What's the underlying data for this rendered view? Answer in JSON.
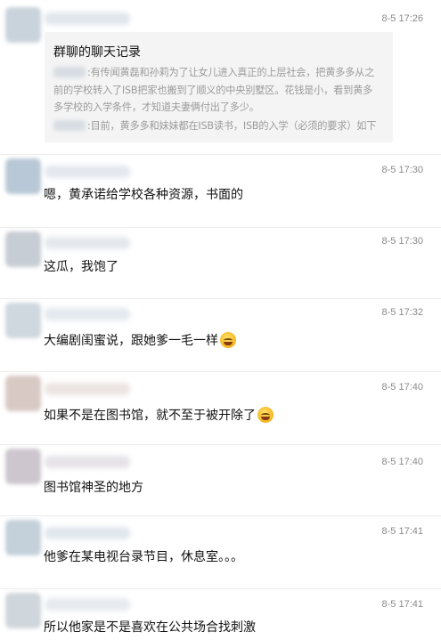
{
  "messages": [
    {
      "time": "8-5 17:26",
      "card": {
        "title": "群聊的聊天记录",
        "lines": [
          ":有传闻黄磊和孙莉为了让女儿进入真正的上层社会，把黄多多从之",
          "前的学校转入了ISB把家也搬到了顺义的中央别墅区。花钱是小，看到黄多",
          "多学校的入学条件，才知道夫妻俩付出了多少。",
          ":目前，黄多多和妹妹都在ISB读书，ISB的入学（必须的要求）如下"
        ]
      },
      "avatar_color": "#c9d3dc"
    },
    {
      "time": "8-5 17:30",
      "text": "嗯，黄承诺给学校各种资源，书面的",
      "avatar_color": "#b9c8d6"
    },
    {
      "time": "8-5 17:30",
      "text": "这瓜，我饱了",
      "avatar_color": "#c7cdd4"
    },
    {
      "time": "8-5 17:32",
      "text": "大编剧闺蜜说，跟她爹一毛一样",
      "emoji": "grinning-sweat-emoji",
      "avatar_color": "#cfd8df"
    },
    {
      "time": "8-5 17:40",
      "text": "如果不是在图书馆，就不至于被开除了",
      "emoji": "grinning-sweat-emoji",
      "avatar_color": "#d8c9c4"
    },
    {
      "time": "8-5 17:40",
      "text": "图书馆神圣的地方",
      "avatar_color": "#cdc6cf"
    },
    {
      "time": "8-5 17:41",
      "text": "他爹在某电视台录节目，休息室。。。",
      "avatar_color": "#c4d0da"
    },
    {
      "time": "8-5 17:41",
      "text": "所以他家是不是喜欢在公共场合找刺激",
      "avatar_color": "#cfd6dc"
    }
  ]
}
